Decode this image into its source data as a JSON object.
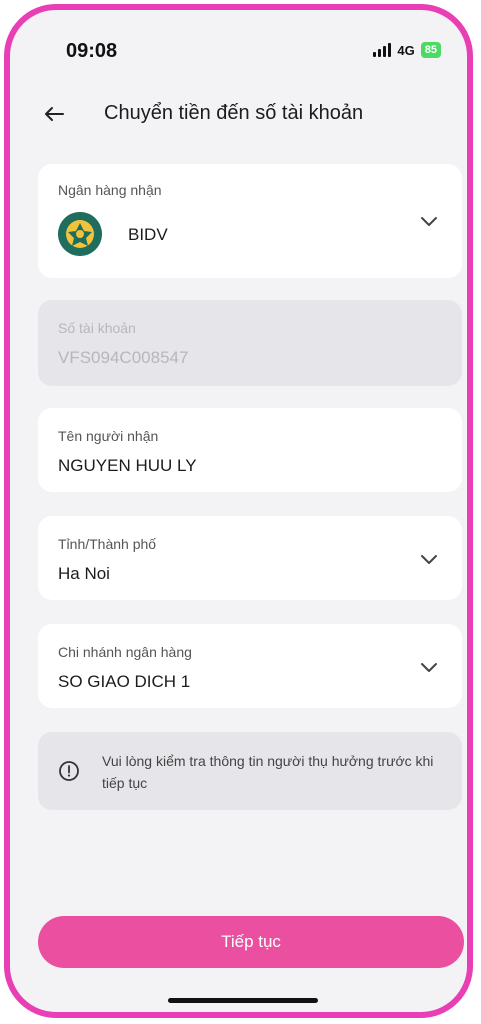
{
  "status": {
    "time": "09:08",
    "network": "4G",
    "battery": "85"
  },
  "header": {
    "title": "Chuyển tiền đến số tài khoản"
  },
  "form": {
    "bank": {
      "label": "Ngân hàng nhận",
      "value": "BIDV",
      "logo_color": "#1f6d5c"
    },
    "account": {
      "label": "Số tài khoản",
      "value": "VFS094C008547"
    },
    "recipient": {
      "label": "Tên người nhận",
      "value": "NGUYEN HUU LY"
    },
    "province": {
      "label": "Tỉnh/Thành phố",
      "value": "Ha Noi"
    },
    "branch": {
      "label": "Chi nhánh ngân hàng",
      "value": "SO GIAO DICH 1"
    }
  },
  "notice": {
    "text": "Vui lòng kiểm tra thông tin người thụ hưởng trước khi tiếp tục",
    "icon": "info-icon"
  },
  "cta": {
    "label": "Tiếp tục",
    "color": "#eb4f9f"
  },
  "theme": {
    "frame": "#e83fb5",
    "background": "#f3f3f6"
  }
}
